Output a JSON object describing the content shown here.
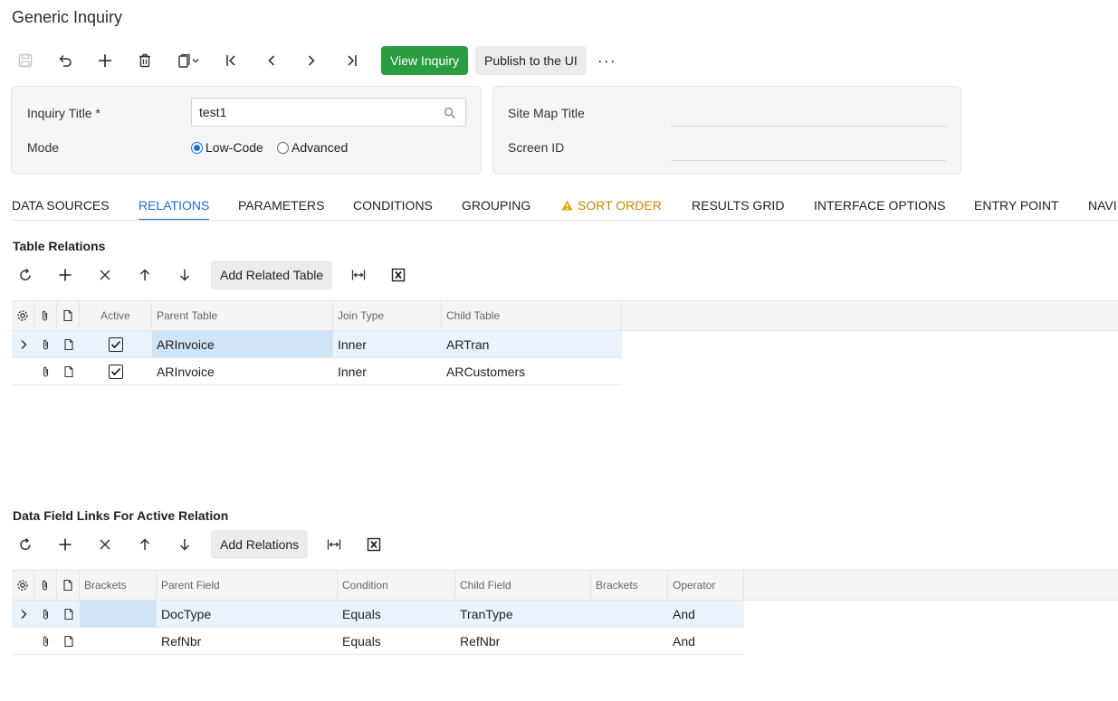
{
  "page": {
    "title": "Generic Inquiry"
  },
  "toolbar": {
    "icons": [
      "save-icon",
      "undo-icon",
      "add-icon",
      "delete-icon",
      "copy-paste-icon",
      "first-record-icon",
      "previous-record-icon",
      "next-record-icon",
      "last-record-icon"
    ],
    "view_inquiry_label": "View Inquiry",
    "publish_label": "Publish to the UI",
    "more_label": "···"
  },
  "form": {
    "inquiry_title_label": "Inquiry Title",
    "required_mark": "*",
    "inquiry_title_value": "test1",
    "mode_label": "Mode",
    "mode_options": [
      "Low-Code",
      "Advanced"
    ],
    "mode_selected": "Low-Code",
    "site_map_title_label": "Site Map Title",
    "screen_id_label": "Screen ID"
  },
  "tabs": [
    "DATA SOURCES",
    "RELATIONS",
    "PARAMETERS",
    "CONDITIONS",
    "GROUPING",
    "SORT ORDER",
    "RESULTS GRID",
    "INTERFACE OPTIONS",
    "ENTRY POINT",
    "NAVI"
  ],
  "active_tab": "RELATIONS",
  "warning_tab": "SORT ORDER",
  "colors": {
    "accent": "#1a6ed8",
    "primary_button": "#2a9d43",
    "warning": "#c58a00",
    "selected_row": "#eaf3fb"
  },
  "table_relations": {
    "title": "Table Relations",
    "add_button_label": "Add Related Table",
    "columns": [
      "Active",
      "Parent Table",
      "Join Type",
      "Child Table"
    ],
    "rows": [
      {
        "active": true,
        "parent_table": "ARInvoice",
        "join_type": "Inner",
        "child_table": "ARTran"
      },
      {
        "active": true,
        "parent_table": "ARInvoice",
        "join_type": "Inner",
        "child_table": "ARCustomers"
      }
    ]
  },
  "field_links": {
    "title": "Data Field Links For Active Relation",
    "add_button_label": "Add Relations",
    "columns": [
      "Brackets",
      "Parent Field",
      "Condition",
      "Child Field",
      "Brackets",
      "Operator"
    ],
    "rows": [
      {
        "open_brackets": "",
        "parent_field": "DocType",
        "condition": "Equals",
        "child_field": "TranType",
        "close_brackets": "",
        "operator": "And"
      },
      {
        "open_brackets": "",
        "parent_field": "RefNbr",
        "condition": "Equals",
        "child_field": "RefNbr",
        "close_brackets": "",
        "operator": "And"
      }
    ]
  }
}
